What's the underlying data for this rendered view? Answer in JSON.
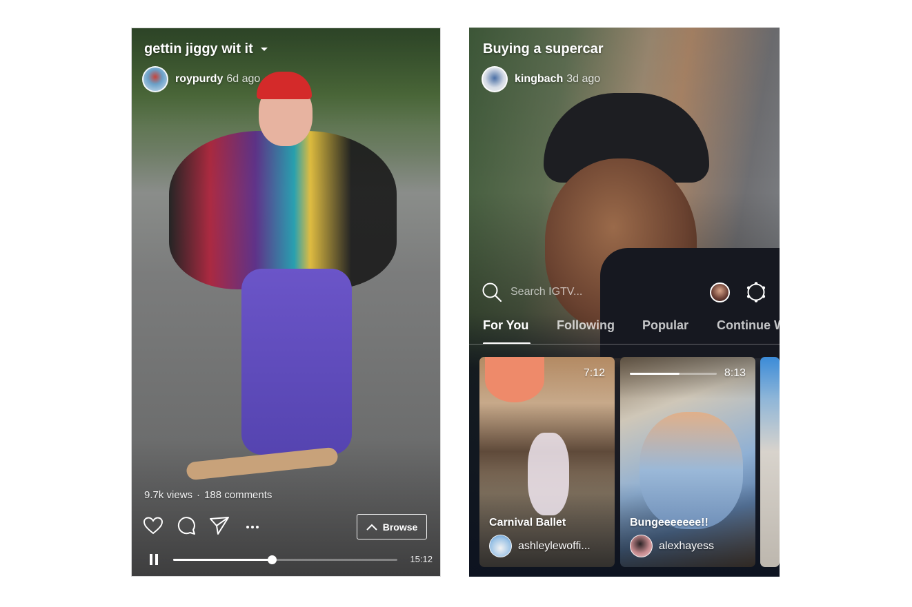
{
  "left_screen": {
    "video_title": "gettin jiggy wit it",
    "author": {
      "username": "roypurdy",
      "time_ago": "6d ago"
    },
    "stats": {
      "views": "9.7k views",
      "separator": "·",
      "comments": "188 comments"
    },
    "actions": [
      "heart-icon",
      "comment-icon",
      "share-icon",
      "more-icon"
    ],
    "browse_label": "Browse",
    "playback": {
      "state": "playing",
      "progress_fraction": 0.44,
      "duration": "15:12"
    }
  },
  "right_screen": {
    "video_title": "Buying a supercar",
    "author": {
      "username": "kingbach",
      "time_ago": "3d ago"
    },
    "search": {
      "placeholder": "Search IGTV..."
    },
    "tabs": [
      {
        "label": "For You",
        "active": true
      },
      {
        "label": "Following",
        "active": false
      },
      {
        "label": "Popular",
        "active": false
      },
      {
        "label": "Continue Watching",
        "active": false
      }
    ],
    "cards": [
      {
        "title": "Carnival Ballet",
        "author": "ashleylewoffi...",
        "duration": "7:12"
      },
      {
        "title": "Bungeeeeeee!!",
        "author": "alexhayess",
        "duration": "8:13",
        "watched_fraction": 0.57
      },
      {
        "title": "",
        "author": "",
        "duration": ""
      }
    ]
  },
  "colors": {
    "text": "#ffffff",
    "background": "#ffffff",
    "panel_dark": "#0d1320"
  }
}
